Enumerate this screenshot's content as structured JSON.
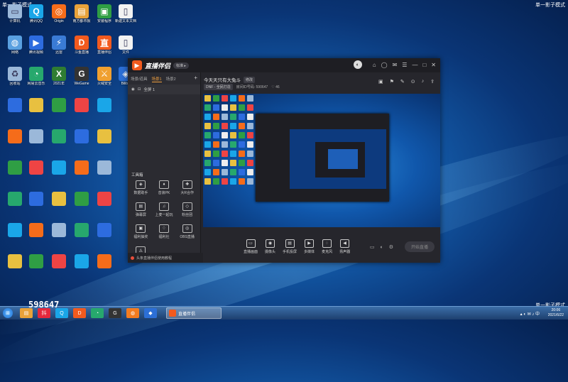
{
  "watermark": {
    "left": "单一影子模式",
    "right": "单一影子模式",
    "right_bottom": "单一影子模式"
  },
  "desktop_icons": [
    {
      "label": "计算机",
      "color": "#9bb8d9",
      "glyph": "▭"
    },
    {
      "label": "腾讯QQ",
      "color": "#1aa6e8",
      "glyph": "Q"
    },
    {
      "label": "Origin",
      "color": "#f56c1a",
      "glyph": "◎"
    },
    {
      "label": "南方都市报",
      "color": "#e8a23a",
      "glyph": "▤"
    },
    {
      "label": "安装程序",
      "color": "#2f9e44",
      "glyph": "▣"
    },
    {
      "label": "新建文本文档",
      "color": "#f2f2f2",
      "glyph": "▯"
    },
    {
      "label": "网络",
      "color": "#5aa0e0",
      "glyph": "◍"
    },
    {
      "label": "腾讯视频",
      "color": "#2d6cdf",
      "glyph": "▶"
    },
    {
      "label": "迅雷",
      "color": "#3a7bd5",
      "glyph": "⚡"
    },
    {
      "label": "斗鱼直播",
      "color": "#f25a1e",
      "glyph": "D"
    },
    {
      "label": "直播伴侣",
      "color": "#f25a1e",
      "glyph": "直"
    },
    {
      "label": "文件",
      "color": "#f2f2f2",
      "glyph": "▯"
    },
    {
      "label": "回收站",
      "color": "#9bb8d9",
      "glyph": "♻"
    },
    {
      "label": "网易云音乐",
      "color": "#27a86d",
      "glyph": "◔"
    },
    {
      "label": "2021年",
      "color": "#2f7d32",
      "glyph": "X"
    },
    {
      "label": "WeGame",
      "color": "#333333",
      "glyph": "G"
    },
    {
      "label": "火绒安全",
      "color": "#f0a030",
      "glyph": "⚔"
    },
    {
      "label": "Bilibili",
      "color": "#2c6fd6",
      "glyph": "◈"
    }
  ],
  "app": {
    "name": "直播伴侣",
    "version_pill": "标准 ▸",
    "avatar_glyph": "◐",
    "window_controls": [
      "⌂",
      "◯",
      "✉",
      "☰",
      "—",
      "□",
      "✕"
    ],
    "tabs": [
      "场景/道具",
      "场景1",
      "场景2"
    ],
    "active_tab_index": 1,
    "add_tab": "+",
    "scene_row": {
      "eye": "◉",
      "lock": "⊡",
      "label": "全屏 1"
    },
    "tools_title": "工具箱",
    "tools": [
      {
        "glyph": "◈",
        "label": "数据助手"
      },
      {
        "glyph": "♦",
        "label": "音浪PK"
      },
      {
        "glyph": "✚",
        "label": "大R合作"
      },
      {
        "glyph": "▤",
        "label": "弹幕屏"
      },
      {
        "glyph": "♫",
        "label": "上麦一起玩"
      },
      {
        "glyph": "◇",
        "label": "粉丝团"
      },
      {
        "glyph": "▣",
        "label": "福利抽奖"
      },
      {
        "glyph": "♢",
        "label": "福利社"
      },
      {
        "glyph": "◎",
        "label": "OBS直播"
      },
      {
        "glyph": "◬",
        "label": "连麦PK"
      }
    ],
    "footer_text": "头条直播伴侣使用教程",
    "room_title": "今天天只有大兔斗",
    "edit_tag": "修改",
    "room_category": "DNF - 全民打造",
    "room_id_label": "房间ID号码: 590647",
    "room_fans": "♡ 46",
    "top_icons": [
      "▣",
      "⚑",
      "✎",
      "⊙",
      "♪",
      "⇪"
    ],
    "bottom_buttons": [
      {
        "glyph": "▭",
        "label": "直播画面"
      },
      {
        "glyph": "◉",
        "label": "摄像头"
      },
      {
        "glyph": "▤",
        "label": "手机投屏"
      },
      {
        "glyph": "▶",
        "label": "多媒体"
      },
      {
        "glyph": "◌",
        "label": "麦克风"
      },
      {
        "glyph": "◀",
        "label": "扬声器"
      }
    ],
    "bottom_right_icons": [
      "▭",
      "◐",
      "⚙"
    ],
    "start_live": "开始直播"
  },
  "taskbar": {
    "start_glyph": "⊞",
    "items": [
      {
        "glyph": "▤",
        "color": "#e8a23a"
      },
      {
        "glyph": "抖",
        "color": "#e4283c"
      },
      {
        "glyph": "Q",
        "color": "#1aa6e8"
      },
      {
        "glyph": "D",
        "color": "#f25a1e"
      },
      {
        "glyph": "◔",
        "color": "#27a86d"
      },
      {
        "glyph": "G",
        "color": "#333333"
      },
      {
        "glyph": "◍",
        "color": "#f47c20"
      },
      {
        "glyph": "◆",
        "color": "#2c6fd6"
      }
    ],
    "active_window_label": "直播伴侣",
    "overlay_number": "598647",
    "tray": "▴ ◐ ✉ ♪ 中",
    "time": "20:06",
    "date": "2021/6/22"
  }
}
